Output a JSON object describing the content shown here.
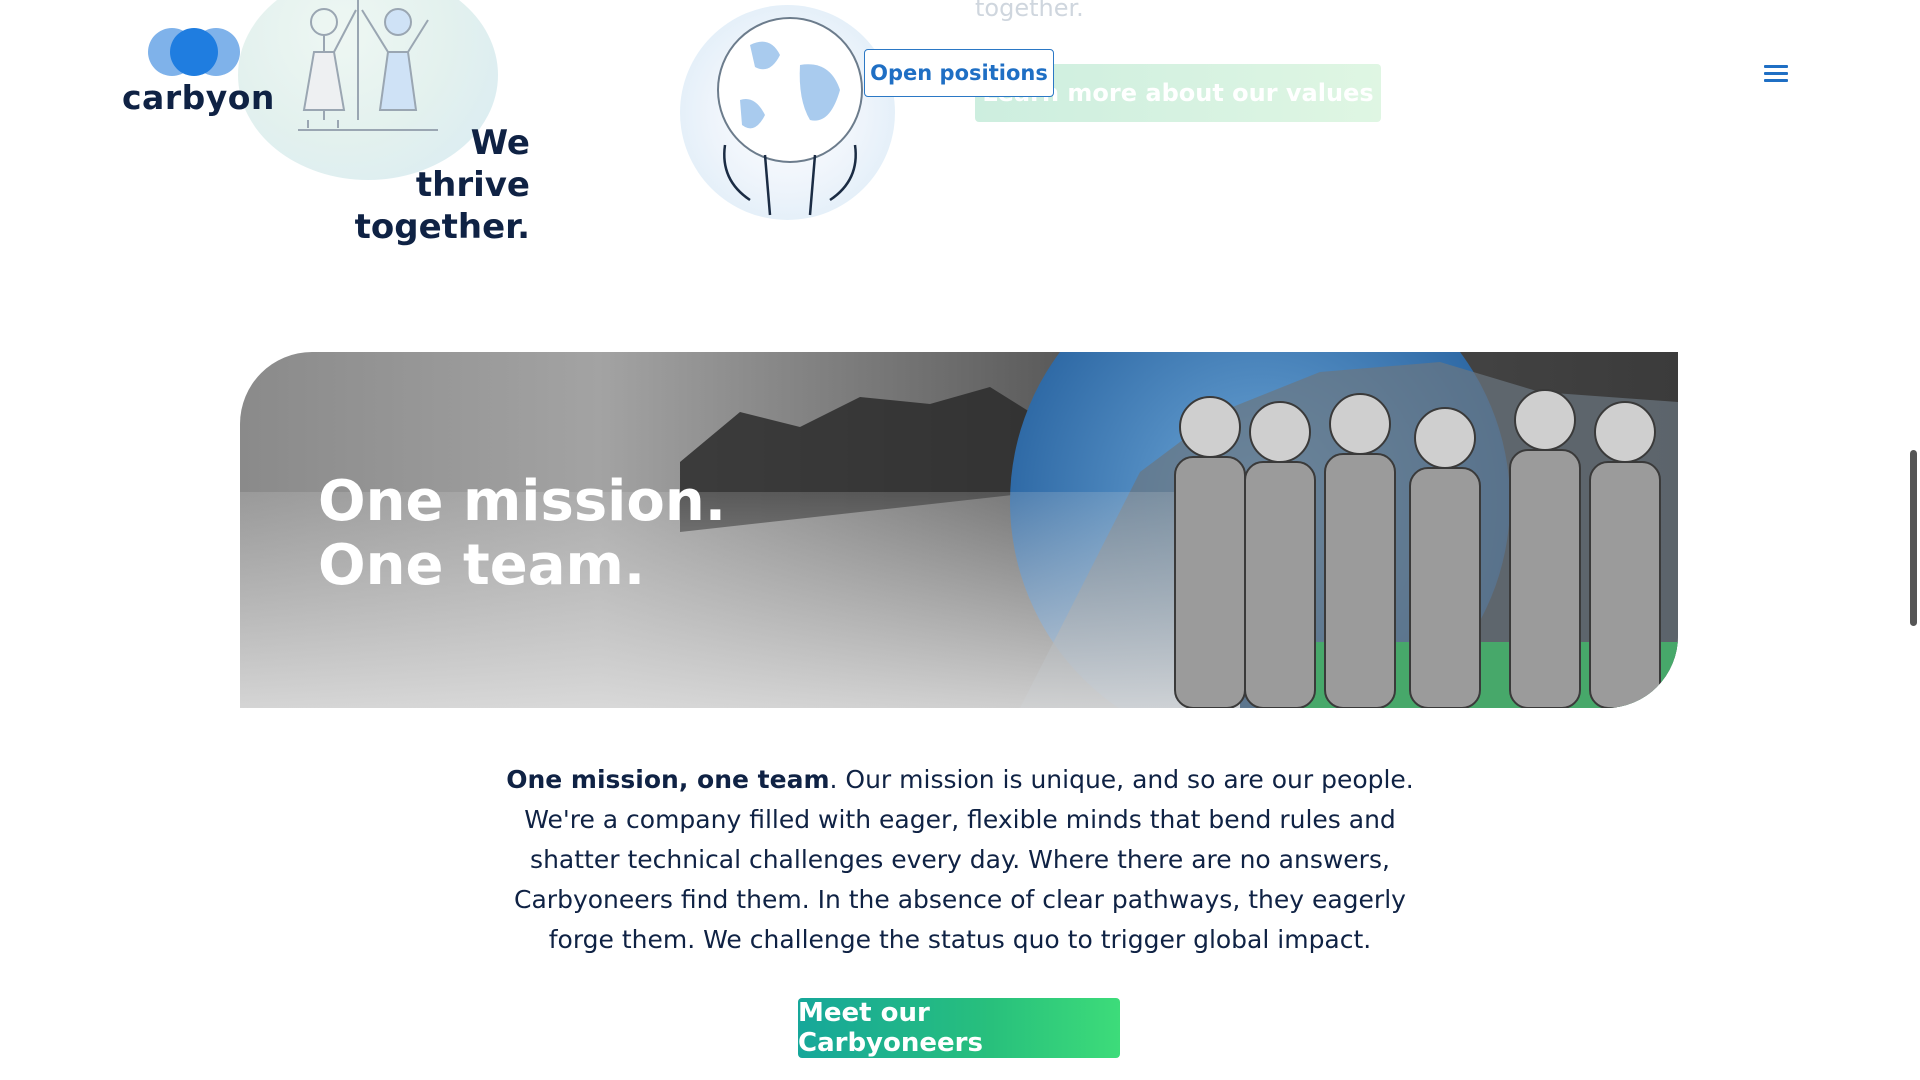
{
  "header": {
    "logo_text": "carbyon",
    "open_positions_label": "Open positions",
    "menu_icon": "hamburger-menu-icon"
  },
  "values_section": {
    "thrive_line1": "We",
    "thrive_line2": "thrive",
    "thrive_line3": "together.",
    "faded_text": "together.",
    "faded_button_label": "Learn more about our values"
  },
  "banner": {
    "title_line1": "One mission.",
    "title_line2": "One team."
  },
  "mission": {
    "lead_bold": "One mission, one team",
    "body": ". Our mission is unique, and so are our people. We're a company filled with eager, flexible minds that bend rules and shatter technical challenges every day. Where there are no answers, Carbyoneers find them. In the absence of clear pathways, they eagerly forge them. We challenge the status quo to trigger global impact."
  },
  "cta": {
    "label": "Meet our Carbyoneers"
  },
  "colors": {
    "navy": "#0f2244",
    "brand_blue": "#2b78c5",
    "cta_green_start": "#16a79a",
    "cta_green_end": "#3ddc7a"
  }
}
